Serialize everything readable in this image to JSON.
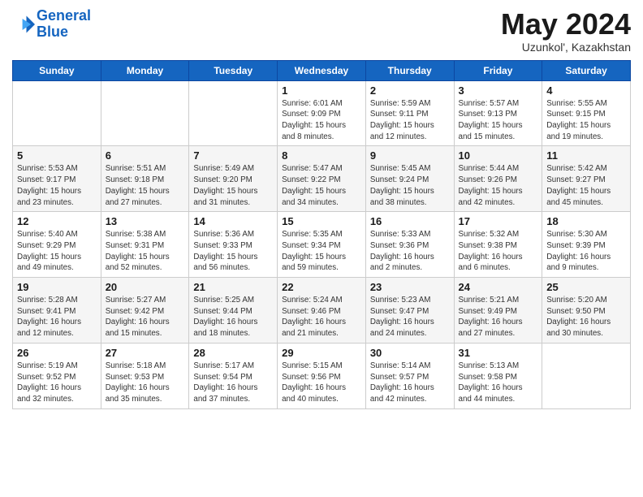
{
  "logo": {
    "line1": "General",
    "line2": "Blue"
  },
  "title": "May 2024",
  "location": "Uzunkol', Kazakhstan",
  "days_of_week": [
    "Sunday",
    "Monday",
    "Tuesday",
    "Wednesday",
    "Thursday",
    "Friday",
    "Saturday"
  ],
  "weeks": [
    [
      {
        "day": "",
        "info": ""
      },
      {
        "day": "",
        "info": ""
      },
      {
        "day": "",
        "info": ""
      },
      {
        "day": "1",
        "info": "Sunrise: 6:01 AM\nSunset: 9:09 PM\nDaylight: 15 hours\nand 8 minutes."
      },
      {
        "day": "2",
        "info": "Sunrise: 5:59 AM\nSunset: 9:11 PM\nDaylight: 15 hours\nand 12 minutes."
      },
      {
        "day": "3",
        "info": "Sunrise: 5:57 AM\nSunset: 9:13 PM\nDaylight: 15 hours\nand 15 minutes."
      },
      {
        "day": "4",
        "info": "Sunrise: 5:55 AM\nSunset: 9:15 PM\nDaylight: 15 hours\nand 19 minutes."
      }
    ],
    [
      {
        "day": "5",
        "info": "Sunrise: 5:53 AM\nSunset: 9:17 PM\nDaylight: 15 hours\nand 23 minutes."
      },
      {
        "day": "6",
        "info": "Sunrise: 5:51 AM\nSunset: 9:18 PM\nDaylight: 15 hours\nand 27 minutes."
      },
      {
        "day": "7",
        "info": "Sunrise: 5:49 AM\nSunset: 9:20 PM\nDaylight: 15 hours\nand 31 minutes."
      },
      {
        "day": "8",
        "info": "Sunrise: 5:47 AM\nSunset: 9:22 PM\nDaylight: 15 hours\nand 34 minutes."
      },
      {
        "day": "9",
        "info": "Sunrise: 5:45 AM\nSunset: 9:24 PM\nDaylight: 15 hours\nand 38 minutes."
      },
      {
        "day": "10",
        "info": "Sunrise: 5:44 AM\nSunset: 9:26 PM\nDaylight: 15 hours\nand 42 minutes."
      },
      {
        "day": "11",
        "info": "Sunrise: 5:42 AM\nSunset: 9:27 PM\nDaylight: 15 hours\nand 45 minutes."
      }
    ],
    [
      {
        "day": "12",
        "info": "Sunrise: 5:40 AM\nSunset: 9:29 PM\nDaylight: 15 hours\nand 49 minutes."
      },
      {
        "day": "13",
        "info": "Sunrise: 5:38 AM\nSunset: 9:31 PM\nDaylight: 15 hours\nand 52 minutes."
      },
      {
        "day": "14",
        "info": "Sunrise: 5:36 AM\nSunset: 9:33 PM\nDaylight: 15 hours\nand 56 minutes."
      },
      {
        "day": "15",
        "info": "Sunrise: 5:35 AM\nSunset: 9:34 PM\nDaylight: 15 hours\nand 59 minutes."
      },
      {
        "day": "16",
        "info": "Sunrise: 5:33 AM\nSunset: 9:36 PM\nDaylight: 16 hours\nand 2 minutes."
      },
      {
        "day": "17",
        "info": "Sunrise: 5:32 AM\nSunset: 9:38 PM\nDaylight: 16 hours\nand 6 minutes."
      },
      {
        "day": "18",
        "info": "Sunrise: 5:30 AM\nSunset: 9:39 PM\nDaylight: 16 hours\nand 9 minutes."
      }
    ],
    [
      {
        "day": "19",
        "info": "Sunrise: 5:28 AM\nSunset: 9:41 PM\nDaylight: 16 hours\nand 12 minutes."
      },
      {
        "day": "20",
        "info": "Sunrise: 5:27 AM\nSunset: 9:42 PM\nDaylight: 16 hours\nand 15 minutes."
      },
      {
        "day": "21",
        "info": "Sunrise: 5:25 AM\nSunset: 9:44 PM\nDaylight: 16 hours\nand 18 minutes."
      },
      {
        "day": "22",
        "info": "Sunrise: 5:24 AM\nSunset: 9:46 PM\nDaylight: 16 hours\nand 21 minutes."
      },
      {
        "day": "23",
        "info": "Sunrise: 5:23 AM\nSunset: 9:47 PM\nDaylight: 16 hours\nand 24 minutes."
      },
      {
        "day": "24",
        "info": "Sunrise: 5:21 AM\nSunset: 9:49 PM\nDaylight: 16 hours\nand 27 minutes."
      },
      {
        "day": "25",
        "info": "Sunrise: 5:20 AM\nSunset: 9:50 PM\nDaylight: 16 hours\nand 30 minutes."
      }
    ],
    [
      {
        "day": "26",
        "info": "Sunrise: 5:19 AM\nSunset: 9:52 PM\nDaylight: 16 hours\nand 32 minutes."
      },
      {
        "day": "27",
        "info": "Sunrise: 5:18 AM\nSunset: 9:53 PM\nDaylight: 16 hours\nand 35 minutes."
      },
      {
        "day": "28",
        "info": "Sunrise: 5:17 AM\nSunset: 9:54 PM\nDaylight: 16 hours\nand 37 minutes."
      },
      {
        "day": "29",
        "info": "Sunrise: 5:15 AM\nSunset: 9:56 PM\nDaylight: 16 hours\nand 40 minutes."
      },
      {
        "day": "30",
        "info": "Sunrise: 5:14 AM\nSunset: 9:57 PM\nDaylight: 16 hours\nand 42 minutes."
      },
      {
        "day": "31",
        "info": "Sunrise: 5:13 AM\nSunset: 9:58 PM\nDaylight: 16 hours\nand 44 minutes."
      },
      {
        "day": "",
        "info": ""
      }
    ]
  ]
}
